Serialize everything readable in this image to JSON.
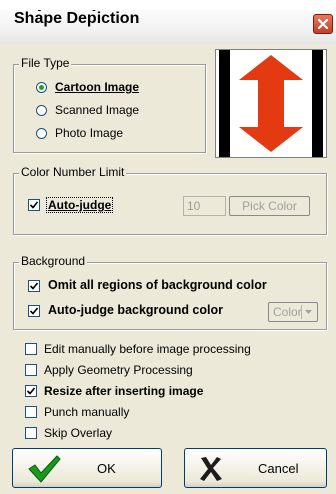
{
  "window": {
    "title_top": "Shape Depiction",
    "title": "Shape Depiction"
  },
  "file_type": {
    "legend": "File Type",
    "options": [
      {
        "label": "Cartoon Image",
        "selected": true
      },
      {
        "label": "Scanned Image",
        "selected": false
      },
      {
        "label": "Photo Image",
        "selected": false
      }
    ]
  },
  "color_limit": {
    "legend": "Color Number Limit",
    "auto_judge_label": "Auto-judge",
    "auto_judge_checked": true,
    "count_value": "10",
    "pick_color_label": "Pick Color"
  },
  "background": {
    "legend": "Background",
    "omit_label": "Omit all regions of background color",
    "omit_checked": true,
    "auto_label": "Auto-judge background color",
    "auto_checked": true,
    "color_dropdown_label": "Color"
  },
  "options": [
    {
      "label": "Edit manually before image processing",
      "checked": false,
      "bold": false
    },
    {
      "label": "Apply Geometry Processing",
      "checked": false,
      "bold": false
    },
    {
      "label": "Resize after inserting image",
      "checked": true,
      "bold": true
    },
    {
      "label": "Punch manually",
      "checked": false,
      "bold": false
    },
    {
      "label": "Skip Overlay",
      "checked": false,
      "bold": false
    }
  ],
  "buttons": {
    "ok_label": "OK",
    "cancel_label": "Cancel"
  },
  "colors": {
    "shape_red": "#e33a12",
    "check_green": "#21a121",
    "ok_green": "#1a9a1a"
  }
}
